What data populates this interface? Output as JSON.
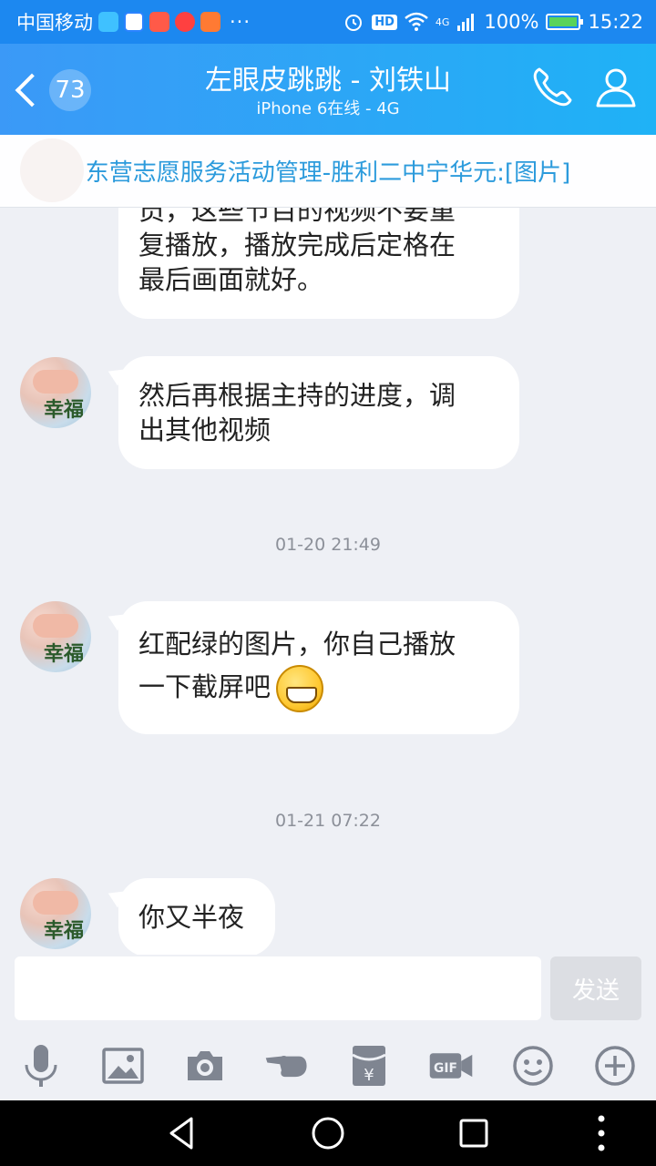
{
  "status_bar": {
    "carrier": "中国移动",
    "network": "4G",
    "hd": "HD",
    "battery": "100%",
    "time": "15:22"
  },
  "header": {
    "back_count": "73",
    "title": "左眼皮跳跳 - 刘铁山",
    "subtitle": "iPhone 6在线 - 4G"
  },
  "notice": {
    "text": "东营志愿服务活动管理-胜利二中宁华元:[图片]"
  },
  "messages": [
    {
      "type": "text",
      "text_lines": [
        "员，这些节目的视频不要重",
        "复播放，播放完成后定格在",
        "最后画面就好。"
      ]
    },
    {
      "type": "text",
      "text_lines": [
        "然后再根据主持的进度，调",
        "出其他视频"
      ]
    },
    {
      "type": "timestamp",
      "text": "01-20 21:49"
    },
    {
      "type": "text",
      "text_lines": [
        "红配绿的图片，你自己播放",
        "一下截屏吧"
      ],
      "emoji": "grin-emoji"
    },
    {
      "type": "timestamp",
      "text": "01-21 07:22"
    },
    {
      "type": "text",
      "text_lines": [
        "你又半夜"
      ]
    }
  ],
  "input": {
    "value": "",
    "send_label": "发送"
  },
  "toolbar_icons": [
    "microphone-icon",
    "image-icon",
    "camera-icon",
    "poke-icon",
    "red-packet-icon",
    "gif-icon",
    "emoji-icon",
    "plus-icon"
  ],
  "colors": {
    "header_start": "#3b99f7",
    "header_end": "#1fb2f6",
    "notice_text": "#2c9bdc",
    "chat_bg": "#eef0f5"
  }
}
